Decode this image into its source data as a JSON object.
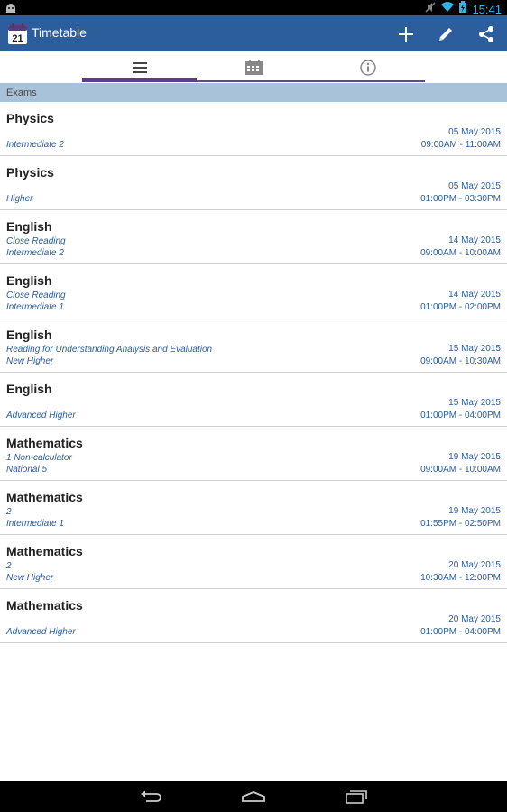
{
  "status_bar": {
    "time": "15:41"
  },
  "action_bar": {
    "title": "Timetable",
    "icons": {
      "app": "calendar-21-icon",
      "add": "plus-icon",
      "edit": "pencil-icon",
      "share": "share-icon"
    },
    "app_icon_day": "21"
  },
  "tabs": [
    {
      "icon": "list-icon",
      "selected": true
    },
    {
      "icon": "calendar-icon",
      "selected": false
    },
    {
      "icon": "info-icon",
      "selected": false
    }
  ],
  "section": {
    "title": "Exams"
  },
  "exams": [
    {
      "subject": "Physics",
      "paper": "",
      "level": "Intermediate 2",
      "date": "05 May 2015",
      "time": "09:00AM - 11:00AM"
    },
    {
      "subject": "Physics",
      "paper": "",
      "level": "Higher",
      "date": "05 May 2015",
      "time": "01:00PM - 03:30PM"
    },
    {
      "subject": "English",
      "paper": "Close Reading",
      "level": "Intermediate 2",
      "date": "14 May 2015",
      "time": "09:00AM - 10:00AM"
    },
    {
      "subject": "English",
      "paper": "Close Reading",
      "level": "Intermediate 1",
      "date": "14 May 2015",
      "time": "01:00PM - 02:00PM"
    },
    {
      "subject": "English",
      "paper": "Reading for Understanding Analysis and Evaluation",
      "level": "New Higher",
      "date": "15 May 2015",
      "time": "09:00AM - 10:30AM"
    },
    {
      "subject": "English",
      "paper": "",
      "level": "Advanced Higher",
      "date": "15 May 2015",
      "time": "01:00PM - 04:00PM"
    },
    {
      "subject": "Mathematics",
      "paper": "1  Non-calculator",
      "level": "National 5",
      "date": "19 May 2015",
      "time": "09:00AM - 10:00AM"
    },
    {
      "subject": "Mathematics",
      "paper": "2",
      "level": "Intermediate 1",
      "date": "19 May 2015",
      "time": "01:55PM - 02:50PM"
    },
    {
      "subject": "Mathematics",
      "paper": "2",
      "level": "New Higher",
      "date": "20 May 2015",
      "time": "10:30AM - 12:00PM"
    },
    {
      "subject": "Mathematics",
      "paper": "",
      "level": "Advanced Higher",
      "date": "20 May 2015",
      "time": "01:00PM - 04:00PM"
    }
  ],
  "nav_bar": {
    "icons": [
      "back-icon",
      "home-icon",
      "recents-icon"
    ]
  },
  "colors": {
    "action_bar": "#2c5d9c",
    "accent_text": "#2c5d9c",
    "section_header": "#a8c2da",
    "tab_indicator": "#5b3d8c"
  }
}
